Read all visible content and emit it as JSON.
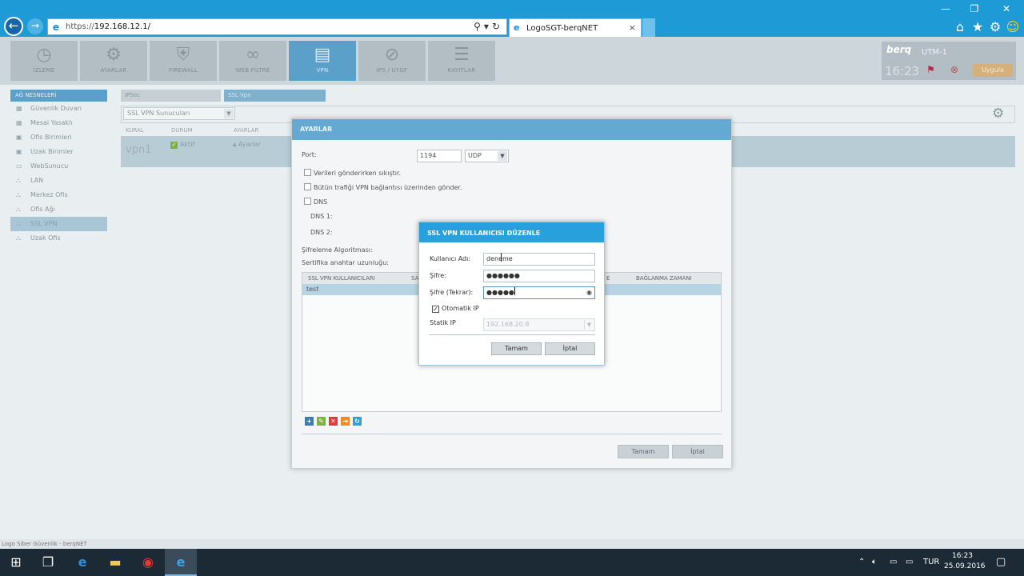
{
  "browser": {
    "url_prefix": "https://",
    "url_host": "192.168.12.1/",
    "tab_title": "LogoSGT-berqNET",
    "tab_close": "×"
  },
  "modules": [
    {
      "label": "İZLEME",
      "icon": "monitor-icon",
      "glyph": "◷"
    },
    {
      "label": "AYARLAR",
      "icon": "settings-icon",
      "glyph": "⚙"
    },
    {
      "label": "FIREWALL",
      "icon": "shield-icon",
      "glyph": "⛨"
    },
    {
      "label": "WEB FİLTRE",
      "icon": "link-icon",
      "glyph": "∞"
    },
    {
      "label": "VPN",
      "icon": "vpn-icon",
      "glyph": "▤"
    },
    {
      "label": "IPS / UYGF",
      "icon": "ips-icon",
      "glyph": "⊘"
    },
    {
      "label": "KAYITLAR",
      "icon": "logs-icon",
      "glyph": "☰"
    }
  ],
  "device": {
    "brand": "berq",
    "name": "UTM-1",
    "time": "16:23",
    "apply_label": "Uygula"
  },
  "sidebar": {
    "title": "AĞ NESNELERİ",
    "items": [
      {
        "label": "Güvenlik Duvarı"
      },
      {
        "label": "Mesai Yasaklı"
      },
      {
        "label": "Ofis Birimleri"
      },
      {
        "label": "Uzak Birimler"
      },
      {
        "label": "WebSunucu"
      },
      {
        "label": "LAN"
      },
      {
        "label": "Merkez Ofis"
      },
      {
        "label": "Ofis Ağı"
      },
      {
        "label": "SSL VPN"
      },
      {
        "label": "Uzak Ofis"
      }
    ]
  },
  "main": {
    "panel_ipsec": "IPSec",
    "panel_sslvpn": "SSL Vpn",
    "server_select": "SSL VPN Sunucuları",
    "columns": [
      "KURAL",
      "DURUM",
      "AYARLAR"
    ],
    "row": {
      "name": "vpn1",
      "status": "Aktif",
      "settings": "Ayarlar"
    }
  },
  "ayarlar": {
    "title": "AYARLAR",
    "port_label": "Port:",
    "port_value": "1194",
    "protocol": "UDP",
    "compress_label": "Verileri gönderirken sıkıştır.",
    "all_traffic_label": "Bütün trafiği VPN bağlantısı üzerinden gönder.",
    "dns_label": "DNS",
    "dns1_label": "DNS 1:",
    "dns2_label": "DNS 2:",
    "encryption_label": "Şifreleme Algoritması:",
    "key_length_label": "Sertifika anahtar uzunluğu:",
    "grid_col_users": "SSL VPN KULLANICILARI",
    "grid_col_sa": "SA",
    "grid_col_e": "E",
    "grid_col_conn": "BAĞLANMA ZAMANI",
    "grid_row_user": "test",
    "ok_label": "Tamam",
    "cancel_label": "İptal"
  },
  "user_dialog": {
    "title": "SSL VPN KULLANICISI DÜZENLE",
    "username_label": "Kullanıcı Adı:",
    "username_value": "deneme",
    "password_label": "Şifre:",
    "password_value": "●●●●●●",
    "password_repeat_label": "Şifre (Tekrar):",
    "password_repeat_value": "●●●●●",
    "auto_ip_label": "Otomatik IP",
    "static_ip_label": "Statik IP",
    "static_ip_value": "192.168.20.8",
    "ok_label": "Tamam",
    "cancel_label": "İptal"
  },
  "status_text": "Logo Siber Güvenlik - berqNET",
  "taskbar": {
    "language": "TUR",
    "time": "16:23",
    "date": "25.09.2016"
  }
}
